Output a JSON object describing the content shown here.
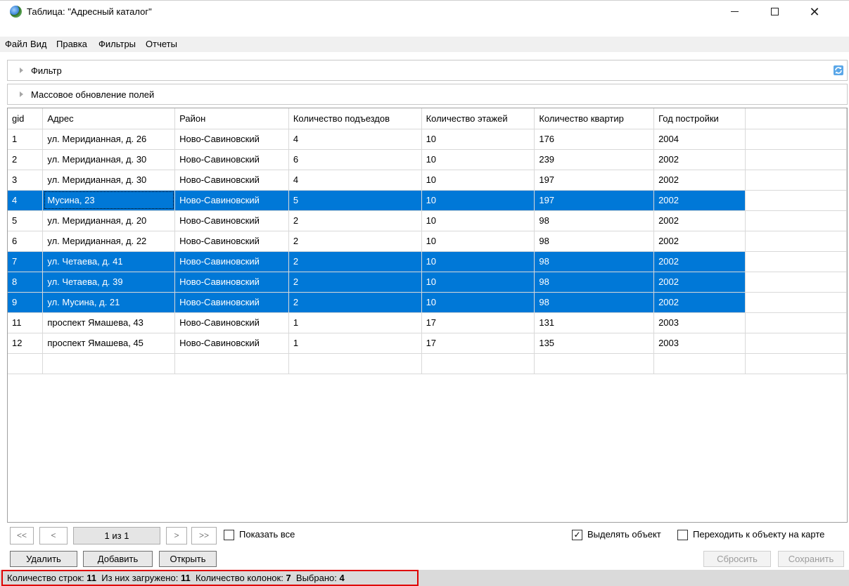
{
  "window": {
    "title": "Таблица: \"Адресный каталог\"",
    "minimize": "—",
    "close": "✕"
  },
  "menu": [
    "Файл",
    "Вид",
    "Правка",
    "Фильтры",
    "Отчеты"
  ],
  "filter_panel": {
    "label": "Фильтр",
    "refresh_icon": "refresh-icon"
  },
  "mass_update_panel": {
    "label": "Массовое обновление полей"
  },
  "table": {
    "columns": [
      "gid",
      "Адрес",
      "Район",
      "Количество подъездов",
      "Количество этажей",
      "Количество квартир",
      "Год постройки"
    ],
    "rows": [
      {
        "selected": false,
        "cells": [
          "1",
          "ул. Меридианная, д. 26",
          "Ново-Савиновский",
          "4",
          "10",
          "176",
          "2004"
        ]
      },
      {
        "selected": false,
        "cells": [
          "2",
          "ул. Меридианная, д. 30",
          "Ново-Савиновский",
          "6",
          "10",
          "239",
          "2002"
        ]
      },
      {
        "selected": false,
        "cells": [
          "3",
          "ул. Меридианная, д. 30",
          "Ново-Савиновский",
          "4",
          "10",
          "197",
          "2002"
        ]
      },
      {
        "selected": true,
        "cells": [
          "4",
          "Мусина, 23",
          "Ново-Савиновский",
          "5",
          "10",
          "197",
          "2002"
        ]
      },
      {
        "selected": false,
        "cells": [
          "5",
          "ул. Меридианная, д. 20",
          "Ново-Савиновский",
          "2",
          "10",
          "98",
          "2002"
        ]
      },
      {
        "selected": false,
        "cells": [
          "6",
          "ул. Меридианная, д. 22",
          "Ново-Савиновский",
          "2",
          "10",
          "98",
          "2002"
        ]
      },
      {
        "selected": true,
        "cells": [
          "7",
          "ул. Четаева, д. 41",
          "Ново-Савиновский",
          "2",
          "10",
          "98",
          "2002"
        ]
      },
      {
        "selected": true,
        "cells": [
          "8",
          "ул. Четаева, д. 39",
          "Ново-Савиновский",
          "2",
          "10",
          "98",
          "2002"
        ]
      },
      {
        "selected": true,
        "cells": [
          "9",
          "ул. Мусина, д. 21",
          "Ново-Савиновский",
          "2",
          "10",
          "98",
          "2002"
        ]
      },
      {
        "selected": false,
        "cells": [
          "11",
          "проспект Ямашева, 43",
          "Ново-Савиновский",
          "1",
          "17",
          "131",
          "2003"
        ]
      },
      {
        "selected": false,
        "cells": [
          "12",
          "проспект Ямашева, 45",
          "Ново-Савиновский",
          "1",
          "17",
          "135",
          "2003"
        ]
      },
      {
        "selected": false,
        "cells": [
          "",
          "",
          "",
          "",
          "",
          "",
          ""
        ]
      }
    ]
  },
  "pager": {
    "first": "<<",
    "prev": "<",
    "page_info": "1 из 1",
    "next": ">",
    "last": ">>",
    "show_all_label": "Показать все",
    "show_all_checked": false
  },
  "options": {
    "highlight_label": "Выделять объект",
    "highlight_checked": true,
    "goto_label": "Переходить к объекту на карте",
    "goto_checked": false
  },
  "buttons": {
    "delete": "Удалить",
    "add": "Добавить",
    "open": "Открыть",
    "reset": "Сбросить",
    "save": "Сохранить"
  },
  "status": {
    "rows_label": "Количество строк:",
    "rows_value": "11",
    "loaded_label": "Из них загружено:",
    "loaded_value": "11",
    "cols_label": "Количество колонок:",
    "cols_value": "7",
    "selected_label": "Выбрано:",
    "selected_value": "4"
  },
  "colors": {
    "selection": "#0078d7",
    "highlight_border": "#e00000"
  }
}
